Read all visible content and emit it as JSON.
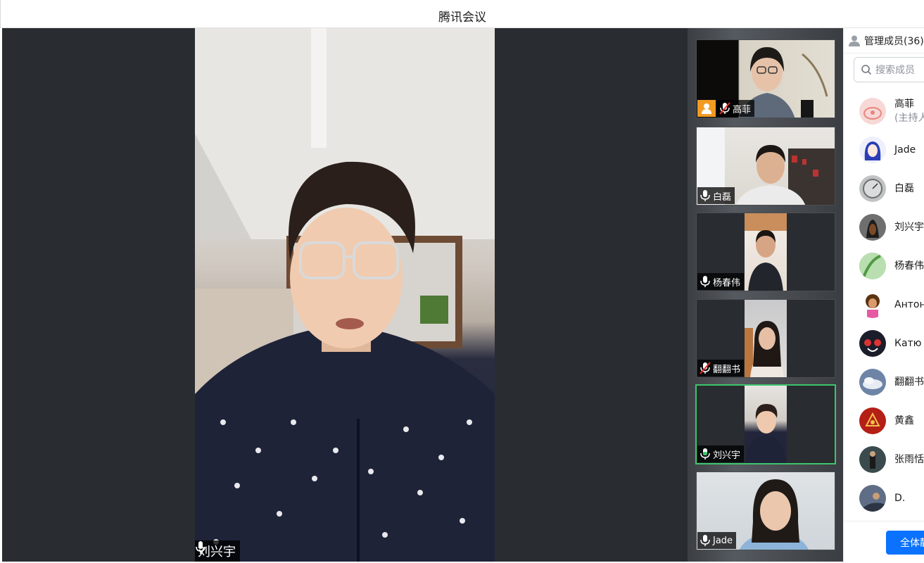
{
  "window": {
    "title": "腾讯会议"
  },
  "main_video": {
    "speaker_name": "刘兴宇",
    "mic_icon": "mic-icon"
  },
  "thumbnails": [
    {
      "name": "高菲",
      "mic": "mic-muted-icon",
      "has_avatar_badge": true
    },
    {
      "name": "白磊",
      "mic": "mic-icon"
    },
    {
      "name": "杨春伟",
      "mic": "mic-icon"
    },
    {
      "name": "翻翻书",
      "mic": "mic-muted-icon"
    },
    {
      "name": "刘兴宇",
      "mic": "mic-speaking-icon",
      "active": true
    },
    {
      "name": "Jade",
      "mic": "mic-icon"
    }
  ],
  "members_panel": {
    "header": "管理成员(36)",
    "search_placeholder": "搜索成员",
    "members": [
      {
        "name": "高菲",
        "sub": "(主持人",
        "avatar_color": "#f7d8d6"
      },
      {
        "name": "Jade",
        "avatar_color": "#eef0fb"
      },
      {
        "name": "白磊",
        "avatar_color": "#bfc3c4"
      },
      {
        "name": "刘兴宇",
        "avatar_color": "#2d2b2a"
      },
      {
        "name": "杨春伟",
        "avatar_color": "#8fc786"
      },
      {
        "name": "Антон",
        "avatar_color": "#f0b23e"
      },
      {
        "name": "Катю",
        "avatar_color": "#1b1d2a"
      },
      {
        "name": "翻翻书",
        "avatar_color": "#6d84a6"
      },
      {
        "name": "黄鑫",
        "avatar_color": "#b41f16"
      },
      {
        "name": "张雨恬",
        "avatar_color": "#3b4a4d"
      },
      {
        "name": "D.",
        "avatar_color": "#5f6e86"
      }
    ],
    "mute_all_label": "全体静音"
  },
  "colors": {
    "accent": "#0a72ff",
    "active_border": "#3ec46d",
    "badge": "#f39a21"
  }
}
